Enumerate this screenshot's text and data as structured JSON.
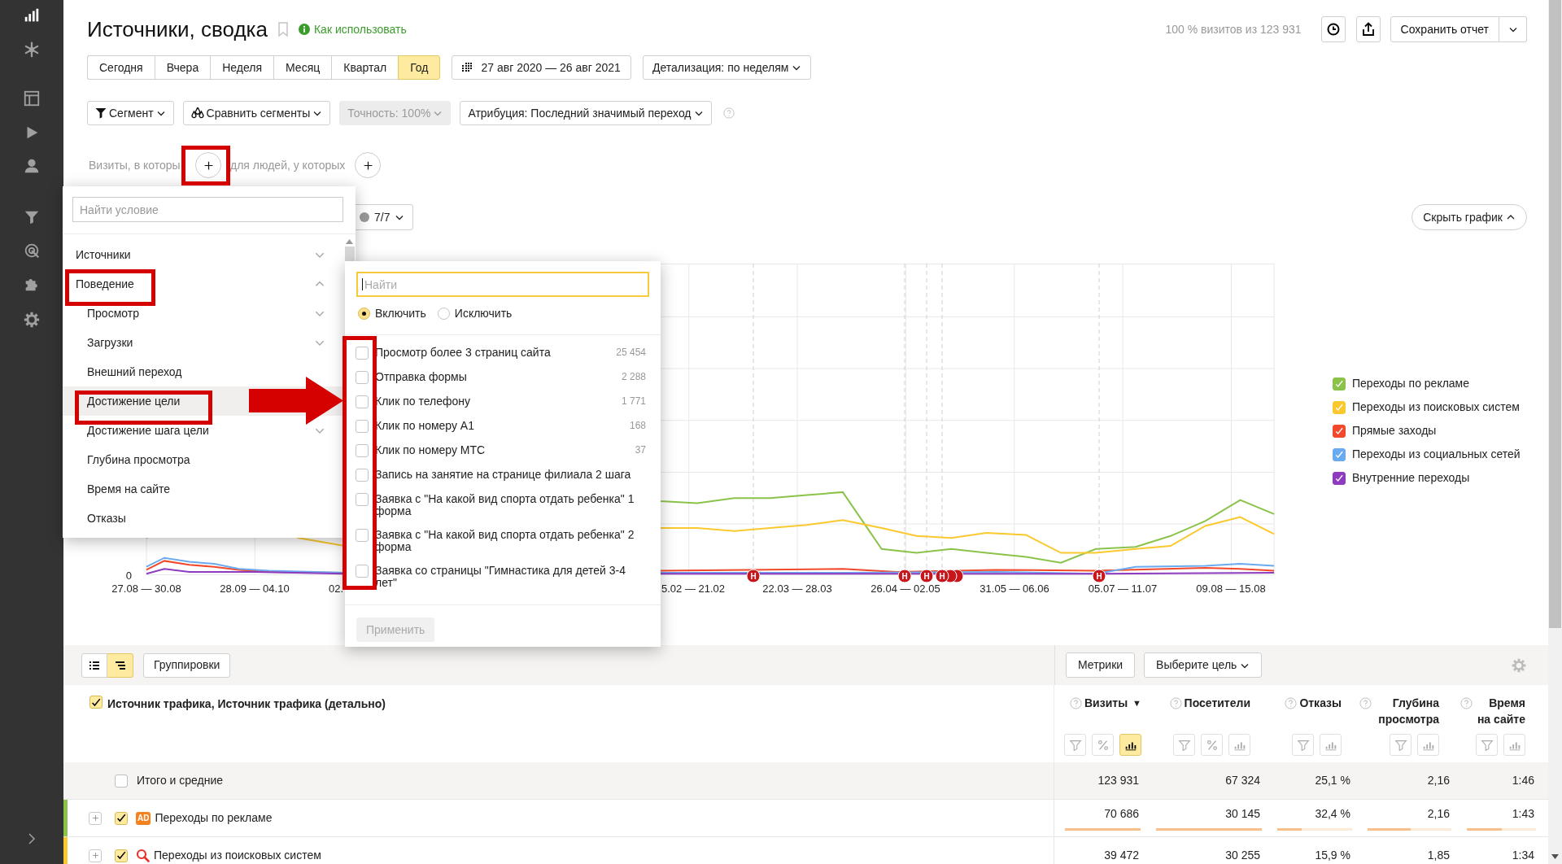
{
  "header": {
    "title": "Источники, сводка",
    "help_link": "Как использовать",
    "visits_share": "100 % визитов из 123 931",
    "save_button": "Сохранить отчет"
  },
  "periods": [
    {
      "label": "Сегодня",
      "selected": false
    },
    {
      "label": "Вчера",
      "selected": false
    },
    {
      "label": "Неделя",
      "selected": false
    },
    {
      "label": "Месяц",
      "selected": false
    },
    {
      "label": "Квартал",
      "selected": false
    },
    {
      "label": "Год",
      "selected": true
    }
  ],
  "date_range": "27 авг 2020 — 26 авг 2021",
  "detail_select": "Детализация: по неделям",
  "segment_controls": [
    {
      "kind": "segment",
      "label": "Сегмент",
      "disabled": false
    },
    {
      "kind": "compare",
      "label": "Сравнить сегменты",
      "disabled": false
    },
    {
      "kind": "plain",
      "label": "Точность: 100%",
      "disabled": true
    },
    {
      "kind": "plain",
      "label": "Атрибуция: Последний значимый переход",
      "disabled": false
    }
  ],
  "conditions": {
    "visits_label": "Визиты, в которы",
    "people_label": "для людей, у которых"
  },
  "chart": {
    "series_toggle": "7/7",
    "hide_button": "Скрыть график",
    "y_label": "0",
    "x_labels": [
      "27.08 — 30.08",
      "28.09 — 04.10",
      "02.",
      "5.02 — 21.02",
      "22.03 — 28.03",
      "26.04 — 02.05",
      "31.05 — 06.06",
      "05.07 — 11.07",
      "09.08 — 15.08"
    ],
    "event_markers": [
      "Н",
      "Н",
      "Н",
      "Н",
      "Н"
    ],
    "legend": [
      {
        "label": "Переходы по рекламе",
        "color": "#8bc34a",
        "checked": true
      },
      {
        "label": "Переходы из поисковых систем",
        "color": "#fbc92d",
        "checked": true
      },
      {
        "label": "Прямые заходы",
        "color": "#f2482b",
        "checked": true
      },
      {
        "label": "Переходы из социальных сетей",
        "color": "#6aaaf0",
        "checked": true
      },
      {
        "label": "Внутренние переходы",
        "color": "#8e3bbf",
        "checked": true
      }
    ]
  },
  "condition_menu": {
    "placeholder": "Найти условие",
    "items": [
      {
        "kind": "group",
        "label": "Источники",
        "expanded": false,
        "selected": false
      },
      {
        "kind": "group",
        "label": "Поведение",
        "expanded": true,
        "selected": false,
        "children": [
          {
            "kind": "group",
            "label": "Просмотр",
            "expanded": false,
            "selected": false
          },
          {
            "kind": "group",
            "label": "Загрузки",
            "expanded": false,
            "selected": false
          },
          {
            "kind": "leaf",
            "label": "Внешний переход",
            "selected": false
          },
          {
            "kind": "leaf",
            "label": "Достижение цели",
            "selected": true
          },
          {
            "kind": "group",
            "label": "Достижение шага цели",
            "expanded": false,
            "selected": false
          },
          {
            "kind": "leaf",
            "label": "Глубина просмотра",
            "selected": false
          },
          {
            "kind": "leaf",
            "label": "Время на сайте",
            "selected": false
          },
          {
            "kind": "leaf",
            "label": "Отказы",
            "selected": false
          }
        ]
      }
    ]
  },
  "goal_menu": {
    "placeholder": "Найти",
    "modes": [
      {
        "label": "Включить",
        "selected": true
      },
      {
        "label": "Исключить",
        "selected": false
      }
    ],
    "goals": [
      {
        "label": "Просмотр более 3 страниц сайта",
        "count": "25 454",
        "checked": false
      },
      {
        "label": "Отправка формы",
        "count": "2 288",
        "checked": false
      },
      {
        "label": "Клик по телефону",
        "count": "1 771",
        "checked": false
      },
      {
        "label": "Клик по номеру А1",
        "count": "168",
        "checked": false
      },
      {
        "label": "Клик по номеру МТС",
        "count": "37",
        "checked": false
      },
      {
        "label": "Запись на занятие на странице филиала 2 шага",
        "checked": false
      },
      {
        "label": "Заявка с \"На какой вид спорта отдать ребенка\" 1 форма",
        "checked": false
      },
      {
        "label": "Заявка с \"На какой вид спорта отдать ребенка\" 2 форма",
        "checked": false
      },
      {
        "label": "Заявка со страницы \"Гимнастика для детей 3-4 лет\"",
        "checked": false
      }
    ],
    "apply_button": {
      "label": "Применить",
      "disabled": true
    }
  },
  "table": {
    "view_modes": [
      {
        "kind": "list",
        "selected": false
      },
      {
        "kind": "tree",
        "selected": true
      }
    ],
    "groupings_button": "Группировки",
    "metrics_button": "Метрики",
    "goal_select": "Выберите цель",
    "dimension_header": {
      "label": "Источник трафика, Источник трафика (детально)",
      "checked": true
    },
    "columns": [
      {
        "label": "Визиты",
        "sort": "▼",
        "tools": [
          {
            "kind": "filter",
            "selected": false
          },
          {
            "kind": "percent",
            "selected": false
          },
          {
            "kind": "chart",
            "selected": true
          }
        ]
      },
      {
        "label": "Посетители",
        "tools": [
          {
            "kind": "filter",
            "selected": false
          },
          {
            "kind": "percent",
            "selected": false
          },
          {
            "kind": "chart",
            "selected": false
          }
        ]
      },
      {
        "label": "Отказы",
        "tools": [
          {
            "kind": "filter",
            "selected": false
          },
          {
            "kind": "chart",
            "selected": false
          }
        ]
      },
      {
        "label": "Глубина просмотра",
        "tools": [
          {
            "kind": "filter",
            "selected": false
          },
          {
            "kind": "chart",
            "selected": false
          }
        ]
      },
      {
        "label": "Время на сайте",
        "tools": [
          {
            "kind": "filter",
            "selected": false
          },
          {
            "kind": "chart",
            "selected": false
          }
        ]
      }
    ],
    "total_row": {
      "label": "Итого и средние",
      "checked": false,
      "cells": [
        {
          "value": "123 931"
        },
        {
          "value": "67 324"
        },
        {
          "value": "25,1 %"
        },
        {
          "value": "2,16"
        },
        {
          "value": "1:46"
        }
      ]
    },
    "rows": [
      {
        "kind": "ad",
        "badge": "AD",
        "label": "Переходы по рекламе",
        "color": "#8bc34a",
        "checked": true,
        "cells": [
          {
            "value": "70 686",
            "level": 1
          },
          {
            "value": "30 145",
            "level": 1
          },
          {
            "value": "32,4 %",
            "level": 0.33
          },
          {
            "value": "2,16",
            "level": 0.51
          },
          {
            "value": "1:43",
            "level": 0.5
          }
        ]
      },
      {
        "kind": "search",
        "label": "Переходы из поисковых систем",
        "color": "#fbc92d",
        "checked": true,
        "cells": [
          {
            "value": "39 472"
          },
          {
            "value": "30 255"
          },
          {
            "value": "15,9 %"
          },
          {
            "value": "1,85"
          },
          {
            "value": "1:34"
          }
        ]
      }
    ]
  }
}
